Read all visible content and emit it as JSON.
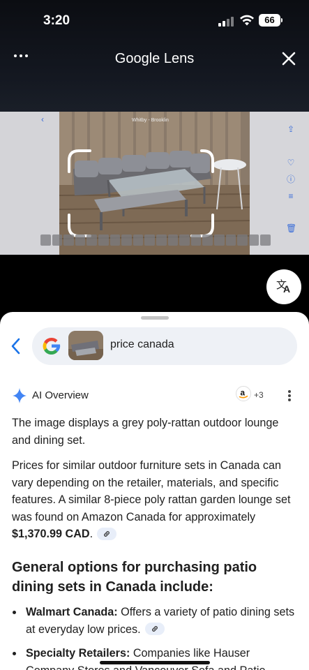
{
  "status_bar": {
    "time": "3:20",
    "battery": "66"
  },
  "header": {
    "title": "Google Lens",
    "menu_icon": "more-dots-icon",
    "close_icon": "close-icon"
  },
  "photo": {
    "subject": "grey rattan outdoor lounge and dining set on wooden deck",
    "overlay_label": "Whitby - Brooklin"
  },
  "translate_button": {
    "icon": "translate-icon"
  },
  "search": {
    "query": "price canada",
    "back_icon": "chevron-left-icon"
  },
  "ai_overview": {
    "label": "AI Overview",
    "sources_count": "+3",
    "paragraph1": "The image displays a grey poly-rattan outdoor lounge and dining set.",
    "paragraph2_lead": "Prices for similar outdoor furniture sets in Canada can vary depending on the retailer, materials, and specific features. A similar 8-piece poly rattan garden lounge set was found on Amazon Canada for approximately ",
    "paragraph2_price": "$1,370.99 CAD",
    "paragraph2_tail": ".",
    "heading": "General options for purchasing patio dining sets in Canada include:",
    "bullets": [
      {
        "title": "Walmart Canada:",
        "text": " Offers a variety of patio dining sets at everyday low prices."
      },
      {
        "title": "Specialty Retailers:",
        "text": " Companies like Hauser Company Stores and Vancouver Sofa and Patio"
      }
    ]
  },
  "colors": {
    "accent_blue": "#1a73e8",
    "sheet_bg": "#ffffff",
    "pill_bg": "#eef1f6"
  }
}
